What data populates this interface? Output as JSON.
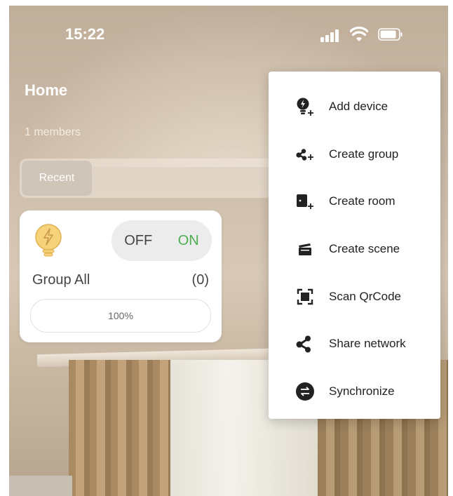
{
  "status_bar": {
    "time": "15:22"
  },
  "home": {
    "title": "Home",
    "members": "1 members",
    "tabs": [
      {
        "label": "Recent"
      }
    ]
  },
  "group_card": {
    "toggle_off": "OFF",
    "toggle_on": "ON",
    "name": "Group All",
    "count": "(0)",
    "brightness": "100%"
  },
  "menu": {
    "items": [
      {
        "label": "Add device",
        "icon": "add-device-icon"
      },
      {
        "label": "Create group",
        "icon": "create-group-icon"
      },
      {
        "label": "Create room",
        "icon": "create-room-icon"
      },
      {
        "label": "Create scene",
        "icon": "create-scene-icon"
      },
      {
        "label": "Scan QrCode",
        "icon": "scan-qrcode-icon"
      },
      {
        "label": "Share network",
        "icon": "share-network-icon"
      },
      {
        "label": "Synchronize",
        "icon": "synchronize-icon"
      }
    ]
  },
  "colors": {
    "on_green": "#4caf50",
    "bulb_yellow": "#f6d37a"
  }
}
